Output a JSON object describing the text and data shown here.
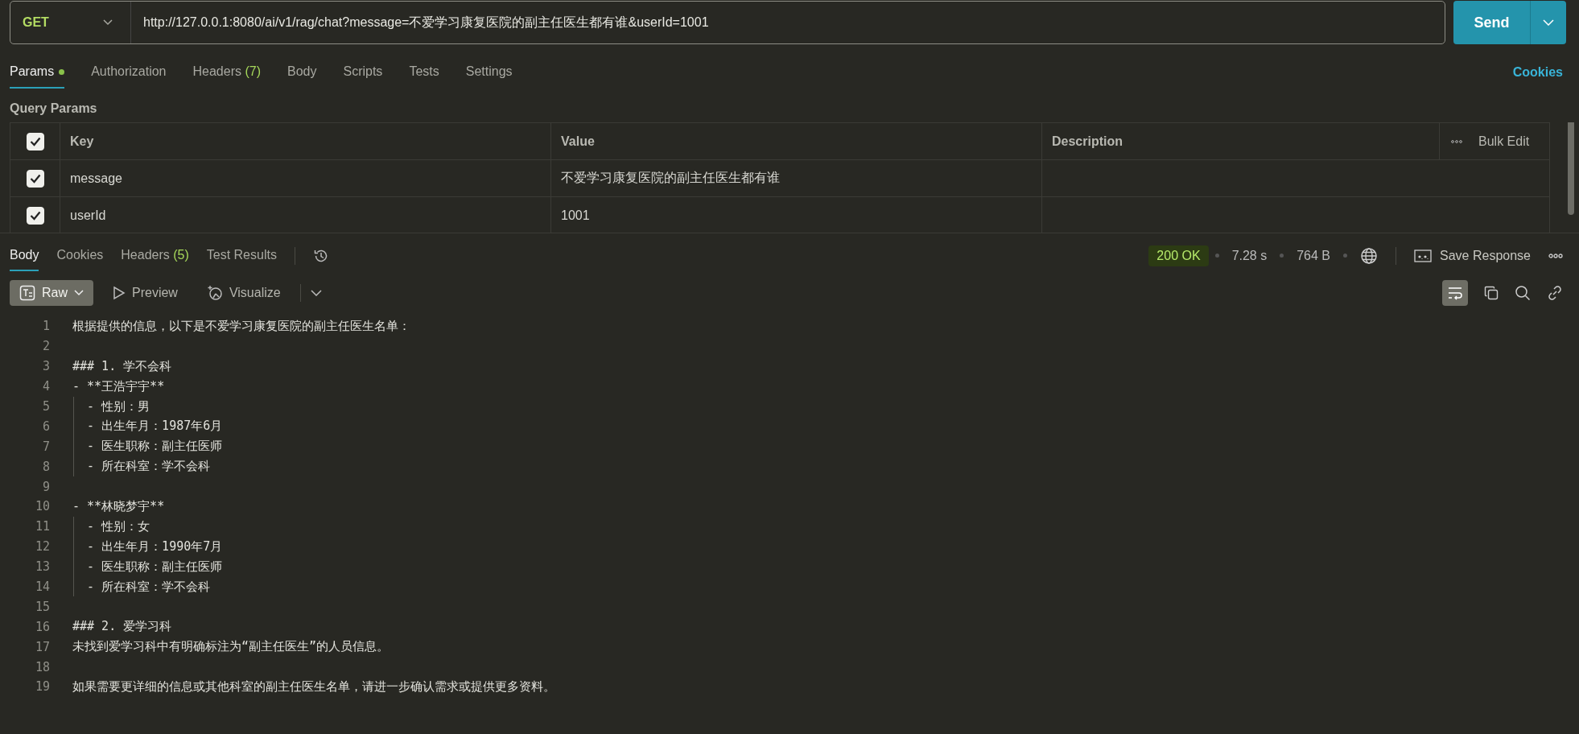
{
  "request": {
    "method": "GET",
    "url": "http://127.0.0.1:8080/ai/v1/rag/chat?message=不爱学习康复医院的副主任医生都有谁&userId=1001",
    "send_label": "Send"
  },
  "request_tabs": [
    {
      "label": "Params",
      "selected": true,
      "dot": true
    },
    {
      "label": "Authorization",
      "selected": false,
      "dot": false
    },
    {
      "label": "Headers",
      "count": "(7)",
      "selected": false,
      "dot": false
    },
    {
      "label": "Body",
      "selected": false,
      "dot": false
    },
    {
      "label": "Scripts",
      "selected": false,
      "dot": false
    },
    {
      "label": "Tests",
      "selected": false,
      "dot": false
    },
    {
      "label": "Settings",
      "selected": false,
      "dot": false
    }
  ],
  "cookies_link": "Cookies",
  "query_params": {
    "title": "Query Params",
    "all_checked": true,
    "columns": [
      "Key",
      "Value",
      "Description"
    ],
    "bulk_edit": "Bulk Edit",
    "rows": [
      {
        "checked": true,
        "key": "message",
        "value": "不爱学习康复医院的副主任医生都有谁"
      },
      {
        "checked": true,
        "key": "userId",
        "value": "1001"
      }
    ]
  },
  "response_tabs": [
    {
      "label": "Body",
      "selected": true
    },
    {
      "label": "Cookies",
      "selected": false
    },
    {
      "label": "Headers",
      "count": "(5)",
      "selected": false
    },
    {
      "label": "Test Results",
      "selected": false
    }
  ],
  "status": {
    "code": "200 OK",
    "time": "7.28 s",
    "size": "764 B",
    "save": "Save Response"
  },
  "view_modes": [
    {
      "kind": "raw",
      "label": "Raw",
      "selected": true
    },
    {
      "kind": "preview",
      "label": "Preview",
      "selected": false
    },
    {
      "kind": "visualize",
      "label": "Visualize",
      "selected": false
    }
  ],
  "wrap_on": true,
  "body_lines": [
    {
      "number": "1",
      "text": "根据提供的信息，以下是不爱学习康复医院的副主任医生名单：",
      "guide": false
    },
    {
      "number": "2",
      "guide": false
    },
    {
      "number": "3",
      "text": "### 1. 学不会科",
      "guide": false
    },
    {
      "number": "4",
      "text": "- **王浩宇宇**",
      "guide": false
    },
    {
      "number": "5",
      "text": "  - 性别：男",
      "guide": true
    },
    {
      "number": "6",
      "text": "  - 出生年月：1987年6月",
      "guide": true
    },
    {
      "number": "7",
      "text": "  - 医生职称：副主任医师",
      "guide": true
    },
    {
      "number": "8",
      "text": "  - 所在科室：学不会科",
      "guide": true
    },
    {
      "number": "9",
      "guide": false
    },
    {
      "number": "10",
      "text": "- **林晓梦宇**",
      "guide": false
    },
    {
      "number": "11",
      "text": "  - 性别：女",
      "guide": true
    },
    {
      "number": "12",
      "text": "  - 出生年月：1990年7月",
      "guide": true
    },
    {
      "number": "13",
      "text": "  - 医生职称：副主任医师",
      "guide": true
    },
    {
      "number": "14",
      "text": "  - 所在科室：学不会科",
      "guide": true
    },
    {
      "number": "15",
      "guide": false
    },
    {
      "number": "16",
      "text": "### 2. 爱学习科",
      "guide": false
    },
    {
      "number": "17",
      "text": "未找到爱学习科中有明确标注为“副主任医生”的人员信息。",
      "guide": false
    },
    {
      "number": "18",
      "guide": false
    },
    {
      "number": "19",
      "text": "如果需要更详细的信息或其他科室的副主任医生名单，请进一步确认需求或提供更多资料。",
      "guide": false
    }
  ]
}
